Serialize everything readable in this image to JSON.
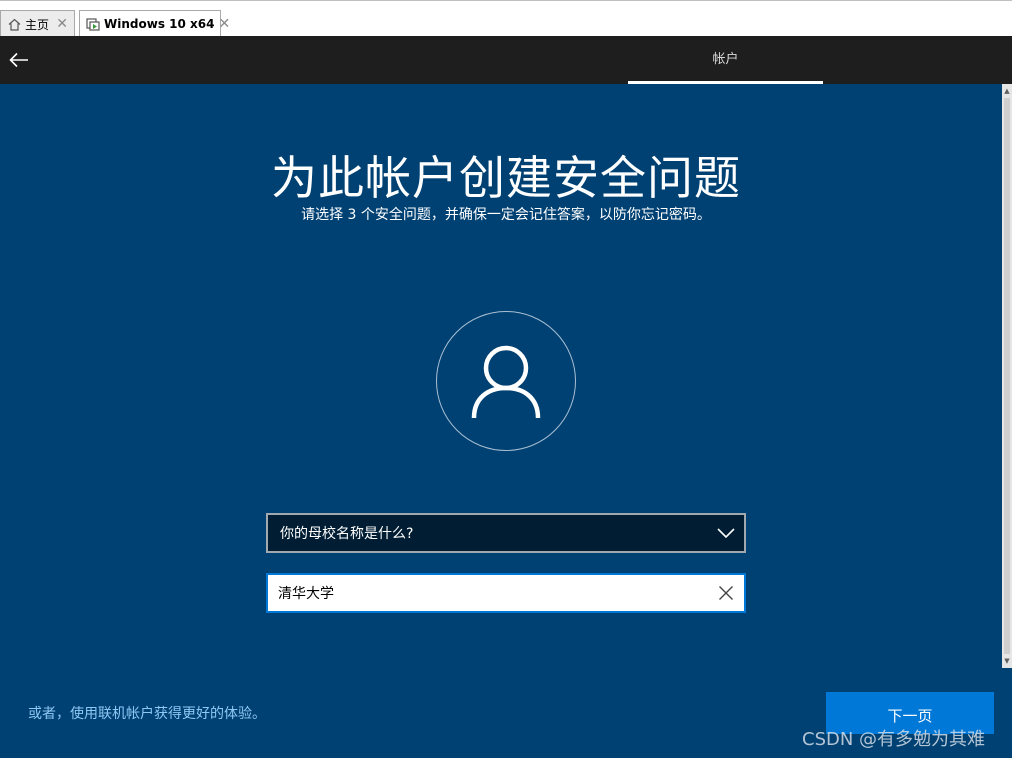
{
  "vm_tabs": {
    "home": {
      "label": "主页",
      "icon": "home-icon",
      "close": "✕"
    },
    "vm": {
      "label": "Windows 10 x64",
      "icon": "vm-icon",
      "close": "✕"
    }
  },
  "topbar": {
    "back_icon": "back-arrow-icon",
    "title": "帐户"
  },
  "page": {
    "heading": "为此帐户创建安全问题",
    "subheading": "请选择 3 个安全问题，并确保一定会记住答案，以防你忘记密码。",
    "avatar_icon": "user-icon"
  },
  "question_select": {
    "selected": "你的母校名称是什么?",
    "icon": "chevron-down-icon"
  },
  "answer_input": {
    "value": "清华大学",
    "clear_icon": "close-icon"
  },
  "footer": {
    "online_link": "或者，使用联机帐户获得更好的体验。",
    "next_label": "下一页"
  },
  "watermark": "CSDN @有多勉为其难",
  "colors": {
    "panel_bg": "#004173",
    "topbar_bg": "#1e1e1e",
    "accent": "#0078d7",
    "link": "#8fc8f5"
  }
}
